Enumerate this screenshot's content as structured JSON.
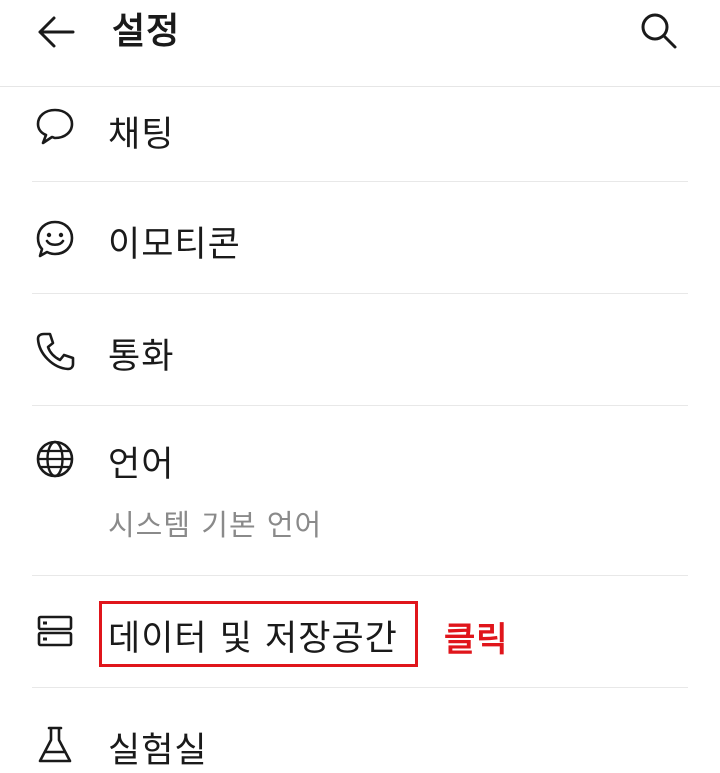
{
  "header": {
    "title": "설정",
    "back_icon": "arrow-left-icon",
    "search_icon": "search-icon"
  },
  "settings": {
    "items": [
      {
        "label": "채팅",
        "icon": "chat-bubble-icon"
      },
      {
        "label": "이모티콘",
        "icon": "smiley-icon"
      },
      {
        "label": "통화",
        "icon": "phone-icon"
      },
      {
        "label": "언어",
        "sub": "시스템 기본 언어",
        "icon": "globe-icon"
      },
      {
        "label": "데이터 및 저장공간",
        "icon": "storage-icon"
      },
      {
        "label": "실험실",
        "icon": "flask-icon"
      }
    ]
  },
  "annotation": {
    "click_note": "클릭",
    "color": "#e0151b"
  }
}
